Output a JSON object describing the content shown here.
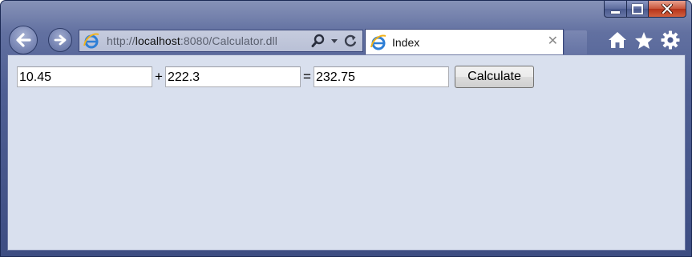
{
  "browser": {
    "address": {
      "scheme": "http://",
      "host": "localhost",
      "rest": ":8080/Calculator.dll"
    },
    "tab": {
      "title": "Index",
      "close_glyph": "✕"
    },
    "icons": {
      "back": "arrow-left-icon",
      "forward": "arrow-right-icon",
      "search": "search-icon",
      "dropdown": "chevron-down-icon",
      "refresh": "refresh-icon",
      "home": "home-icon",
      "favorites": "star-icon",
      "tools": "gear-icon"
    },
    "colors": {
      "frame": "#4f5f93",
      "content_background": "#d9e0ee",
      "close_button": "#c9553b"
    }
  },
  "calculator": {
    "operand1": "10.45",
    "operator": "+",
    "operand2": "222.3",
    "equals": "=",
    "result": "232.75",
    "button_label": "Calculate"
  }
}
